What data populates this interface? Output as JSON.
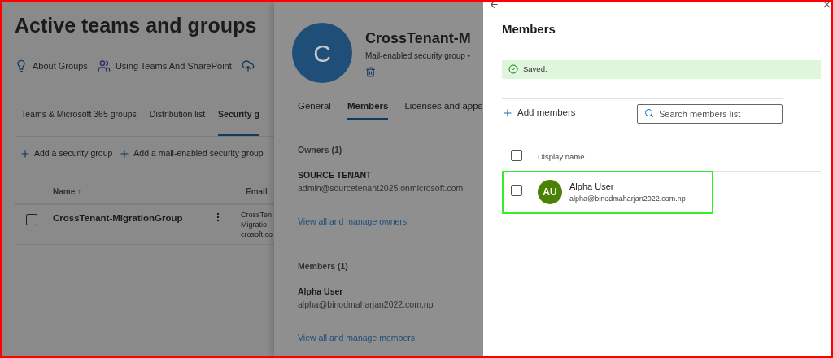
{
  "page": {
    "title": "Active teams and groups",
    "links": [
      {
        "kind": "bulb",
        "label": "About Groups"
      },
      {
        "kind": "teams",
        "label": "Using Teams And SharePoint"
      },
      {
        "kind": "cloud"
      }
    ],
    "tabs": [
      {
        "label": "Teams & Microsoft 365 groups",
        "selected": false
      },
      {
        "label": "Distribution list",
        "selected": false
      },
      {
        "label": "Security g",
        "selected": true
      }
    ],
    "commands": [
      "Add a security group",
      "Add a mail-enabled security group"
    ],
    "table": {
      "columns": [
        "Name ↑",
        "Email"
      ],
      "rows": [
        {
          "checked": false,
          "name": "CrossTenant-MigrationGroup",
          "email": [
            "CrossTen",
            "Migratio",
            "crosoft.co"
          ]
        }
      ]
    }
  },
  "group_panel": {
    "avatar": "C",
    "title": "CrossTenant-M",
    "subtitle": "Mail-enabled security group •",
    "tabs": [
      {
        "label": "General",
        "selected": false
      },
      {
        "label": "Members",
        "selected": true
      },
      {
        "label": "Licenses and apps",
        "selected": false
      }
    ],
    "sections": [
      {
        "heading": "Owners (1)",
        "person": {
          "name": "SOURCE TENANT",
          "email": "admin@sourcetenant2025.onmicrosoft.com"
        },
        "link": "View all and manage owners"
      },
      {
        "heading": "Members (1)",
        "person": {
          "name": "Alpha User",
          "email": "alpha@binodmaharjan2022.com.np"
        },
        "link": "View all and manage members"
      }
    ]
  },
  "members_panel": {
    "title": "Members",
    "notice": "Saved.",
    "add_button": "Add members",
    "search": {
      "placeholder": "Search members list"
    },
    "column": "Display name",
    "header_checked": false,
    "rows": [
      {
        "initials": "AU",
        "color": "#498205",
        "name": "Alpha User",
        "email": "alpha@binodmaharjan2022.com.np",
        "checked": false,
        "highlighted": true
      }
    ]
  }
}
